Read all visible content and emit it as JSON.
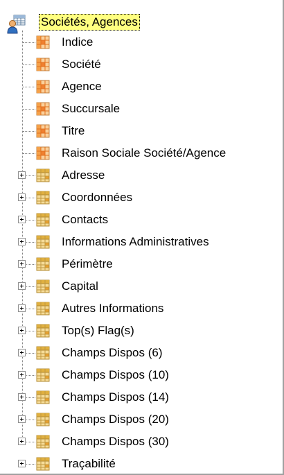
{
  "tree": {
    "root": {
      "label": "Sociétés, Agences",
      "icon": "users-table-icon"
    },
    "field_icon": "field-icon",
    "group_icon": "table-group-icon",
    "colors": {
      "selection": "#ffff80",
      "field_orange": "#f5a14a",
      "group_gold": "#e0b040"
    },
    "items": [
      {
        "label": "Indice",
        "type": "field"
      },
      {
        "label": "Société",
        "type": "field"
      },
      {
        "label": "Agence",
        "type": "field"
      },
      {
        "label": "Succursale",
        "type": "field"
      },
      {
        "label": "Titre",
        "type": "field"
      },
      {
        "label": "Raison Sociale Société/Agence",
        "type": "field"
      },
      {
        "label": "Adresse",
        "type": "group"
      },
      {
        "label": "Coordonnées",
        "type": "group"
      },
      {
        "label": "Contacts",
        "type": "group"
      },
      {
        "label": "Informations Administratives",
        "type": "group"
      },
      {
        "label": "Périmètre",
        "type": "group"
      },
      {
        "label": "Capital",
        "type": "group"
      },
      {
        "label": "Autres Informations",
        "type": "group"
      },
      {
        "label": "Top(s) Flag(s)",
        "type": "group"
      },
      {
        "label": "Champs Dispos (6)",
        "type": "group"
      },
      {
        "label": "Champs Dispos (10)",
        "type": "group"
      },
      {
        "label": "Champs Dispos (14)",
        "type": "group"
      },
      {
        "label": "Champs Dispos (20)",
        "type": "group"
      },
      {
        "label": "Champs Dispos (30)",
        "type": "group"
      },
      {
        "label": "Traçabilité",
        "type": "group"
      }
    ]
  }
}
